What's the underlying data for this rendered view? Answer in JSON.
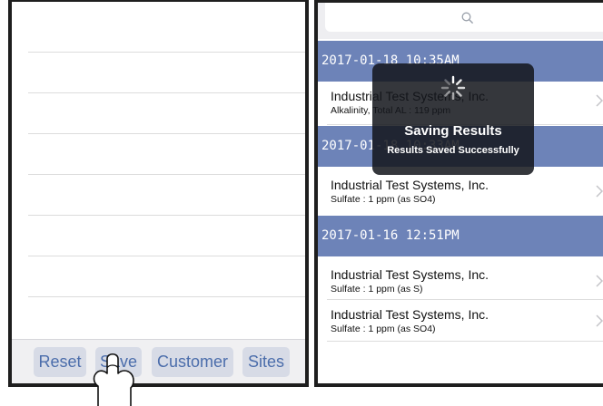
{
  "left_toolbar": {
    "buttons": [
      {
        "label": "Reset"
      },
      {
        "label": "Save"
      },
      {
        "label": "Customer"
      },
      {
        "label": "Sites"
      }
    ]
  },
  "right_panel": {
    "search": {
      "icon": "search-icon"
    },
    "sections": [
      {
        "header": "2017-01-18 10:35AM",
        "rows": [
          {
            "title": "Industrial Test Systems, Inc.",
            "subtitle": "Alkalinity, Total AL : 119 ppm"
          }
        ]
      },
      {
        "header": "2017-01-18 10:33AM",
        "rows": [
          {
            "title": "Industrial Test Systems, Inc.",
            "subtitle": "Sulfate : 1 ppm (as SO4)"
          }
        ]
      },
      {
        "header": "2017-01-16 12:51PM",
        "rows": [
          {
            "title": "Industrial Test Systems, Inc.",
            "subtitle": "Sulfate : 1 ppm (as S)"
          },
          {
            "title": "Industrial Test Systems, Inc.",
            "subtitle": "Sulfate : 1 ppm (as SO4)"
          }
        ]
      }
    ],
    "hud": {
      "title": "Saving Results",
      "subtitle": "Results Saved Successfully"
    }
  },
  "colors": {
    "section_header": "#6d83b8",
    "toolbar_button_bg": "#d7dbe6",
    "toolbar_button_text": "#4b6dab",
    "panel_border": "#1e1e1e",
    "hud_bg": "#14161c"
  }
}
